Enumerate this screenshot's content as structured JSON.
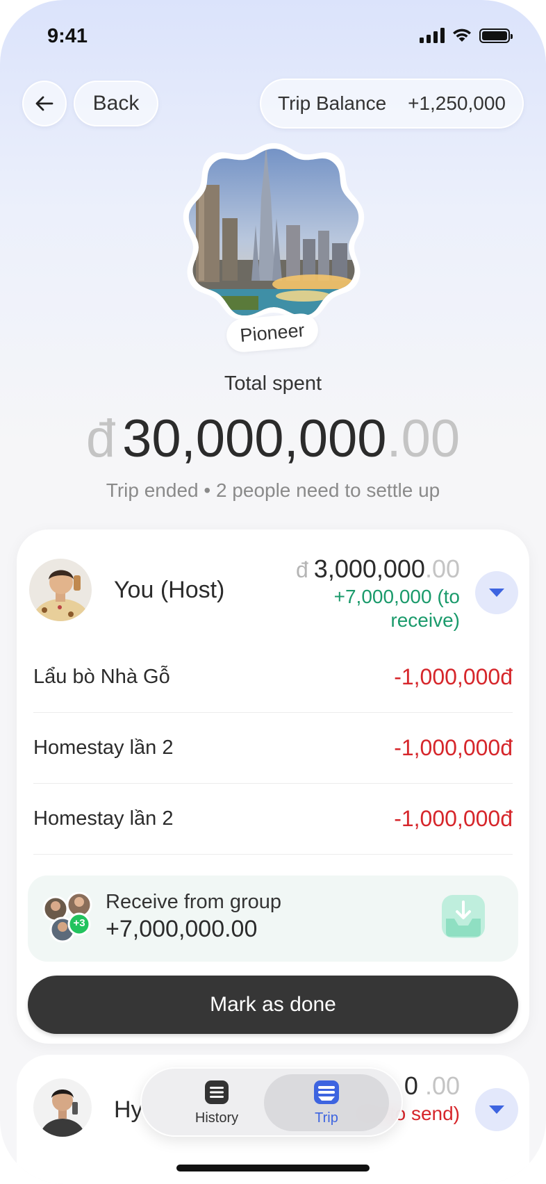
{
  "status_bar": {
    "time": "9:41"
  },
  "header": {
    "back_label": "Back",
    "trip_balance_label": "Trip Balance",
    "trip_balance_value": "+1,250,000"
  },
  "hero": {
    "badge": "Pioneer"
  },
  "summary": {
    "label": "Total spent",
    "currency": "đ",
    "amount": "30,000,000",
    "decimals": ".00",
    "status": "Trip ended • 2 people need to settle up"
  },
  "host_card": {
    "name": "You (Host)",
    "currency": "đ",
    "amount": "3,000,000",
    "decimals": ".00",
    "receive_text": "+7,000,000 (to receive)",
    "expenses": [
      {
        "name": "Lẩu bò Nhà Gỗ",
        "amount": "-1,000,000đ"
      },
      {
        "name": "Homestay lần 2",
        "amount": "-1,000,000đ"
      },
      {
        "name": "Homestay lần 2",
        "amount": "-1,000,000đ"
      }
    ],
    "receive_group": {
      "title": "Receive from group",
      "amount": "+7,000,000.00",
      "extra_count": "+3"
    },
    "mark_done_label": "Mark as done"
  },
  "member_card": {
    "name_partial": "Hy",
    "amount_partial": "0",
    "decimals": ".00",
    "send_text_partial": "00 (to send)"
  },
  "tabbar": {
    "tabs": [
      {
        "label": "History",
        "icon": "history-icon",
        "active": false
      },
      {
        "label": "Trip",
        "icon": "trip-icon",
        "active": true
      }
    ]
  },
  "colors": {
    "accent": "#3d64e0",
    "positive": "#1a9a6b",
    "negative": "#d6262b",
    "primary_button": "#363636"
  }
}
